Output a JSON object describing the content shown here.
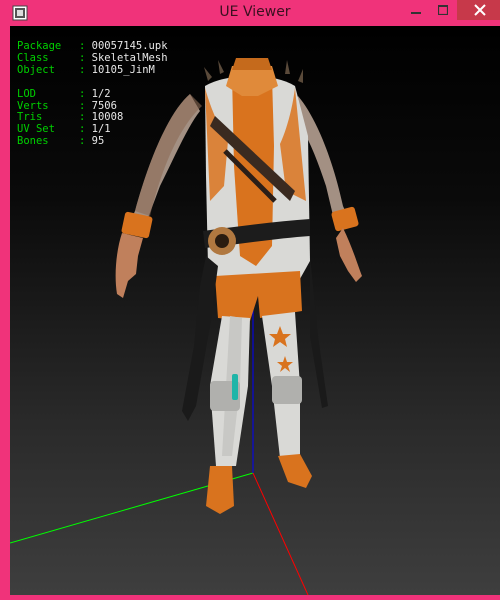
{
  "window": {
    "title": "UE Viewer"
  },
  "info": {
    "package_label": "Package",
    "package_value": "00057145.upk",
    "class_label": "Class",
    "class_value": "SkeletalMesh",
    "object_label": "Object",
    "object_value": "10105_JinM",
    "lod_label": "LOD",
    "lod_value": "1/2",
    "verts_label": "Verts",
    "verts_value": "7506",
    "tris_label": "Tris",
    "tris_value": "10008",
    "uvset_label": "UV Set",
    "uvset_value": "1/1",
    "bones_label": "Bones",
    "bones_value": "95"
  },
  "colors": {
    "titlebar": "#f0337a",
    "close": "#c7394a",
    "label_text": "#00d000",
    "value_text": "#e8e8e8",
    "axis_x": "#ff0000",
    "axis_y": "#00ff00",
    "axis_z": "#0000ff",
    "outfit_orange": "#d9731e",
    "outfit_white": "#d9d9d6"
  },
  "icons": [
    "app-icon",
    "minimize-icon",
    "maximize-icon",
    "close-icon"
  ]
}
